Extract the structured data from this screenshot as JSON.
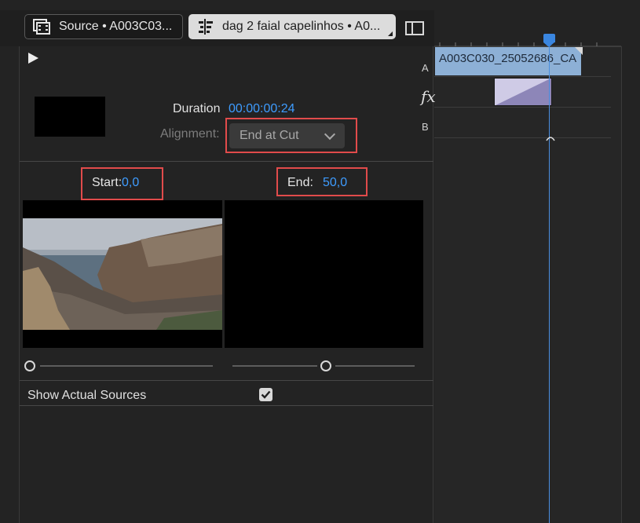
{
  "tabs": {
    "source_label": "Source • A003C03...",
    "sequence_label": "dag 2 faial capelinhos • A0..."
  },
  "transition": {
    "duration_label": "Duration",
    "duration_value": "00:00:00:24",
    "alignment_label": "Alignment:",
    "alignment_value": "End at Cut",
    "start_label": "Start:",
    "start_value": "0,0",
    "end_label": "End:",
    "end_value": "50,0",
    "show_actual_sources_label": "Show Actual Sources",
    "show_actual_sources_checked": true,
    "start_slider_value": 0.0,
    "end_slider_value": 0.5
  },
  "timeline": {
    "track_a_label": "A",
    "track_fx_label": "fx",
    "track_b_label": "B",
    "clip_a_name": "A003C030_25052686_CA"
  },
  "colors": {
    "accent_blue": "#3e9cff",
    "highlight_red": "#e14b4b",
    "clip_blue": "#8db0d6",
    "transition_purple": "#b8b2d8"
  },
  "icons": {
    "source_tab_icon": "clip-icon",
    "sequence_tab_icon": "sequence-icon",
    "panel_toggle_icon": "panel-toggle-icon",
    "play_icon": "play-icon",
    "dropdown_icon": "chevron-down-icon",
    "checkbox_icon": "checkmark-icon"
  }
}
